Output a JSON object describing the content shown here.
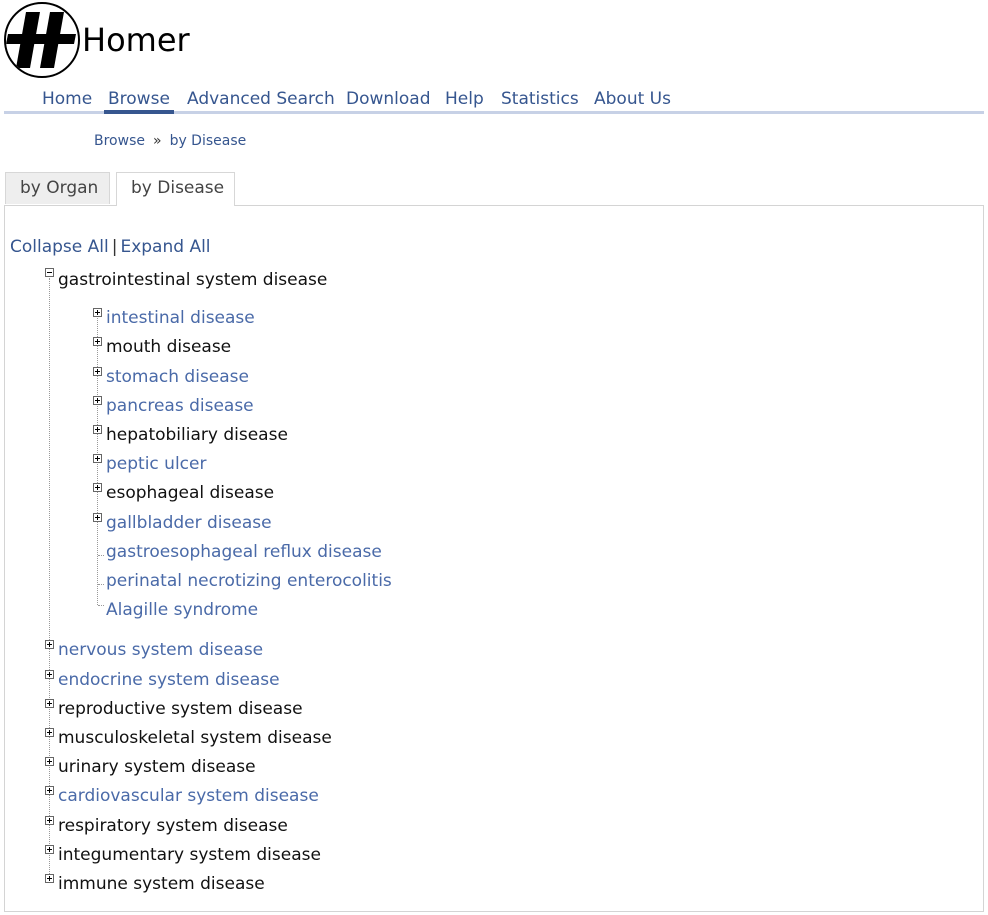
{
  "site": {
    "logo_letter": "H",
    "name": "Homer"
  },
  "nav": [
    {
      "label": "Home"
    },
    {
      "label": "Browse",
      "active": true
    },
    {
      "label": "Advanced Search"
    },
    {
      "label": "Download"
    },
    {
      "label": "Help"
    },
    {
      "label": "Statistics"
    },
    {
      "label": "About Us"
    }
  ],
  "breadcrumb": {
    "items": [
      "Browse",
      "by Disease"
    ],
    "separator": "»"
  },
  "tabs": [
    {
      "label": "by Organ",
      "active": false
    },
    {
      "label": "by Disease",
      "active": true
    }
  ],
  "tree_controls": {
    "collapse_all": "Collapse All",
    "divider": "|",
    "expand_all": "Expand All"
  },
  "tree": {
    "root": {
      "label": "gastrointestinal system disease",
      "expanded": true
    },
    "children": [
      {
        "label": "intestinal disease",
        "link": true,
        "expandable": true
      },
      {
        "label": "mouth disease",
        "link": false,
        "expandable": true
      },
      {
        "label": "stomach disease",
        "link": true,
        "expandable": true
      },
      {
        "label": "pancreas disease",
        "link": true,
        "expandable": true
      },
      {
        "label": "hepatobiliary disease",
        "link": false,
        "expandable": true
      },
      {
        "label": "peptic ulcer",
        "link": true,
        "expandable": true
      },
      {
        "label": "esophageal disease",
        "link": false,
        "expandable": true
      },
      {
        "label": "gallbladder disease",
        "link": true,
        "expandable": true
      },
      {
        "label": "gastroesophageal reflux disease",
        "link": true,
        "expandable": false
      },
      {
        "label": "perinatal necrotizing enterocolitis",
        "link": true,
        "expandable": false
      },
      {
        "label": "Alagille syndrome",
        "link": true,
        "expandable": false
      }
    ],
    "siblings": [
      {
        "label": "nervous system disease",
        "link": true
      },
      {
        "label": "endocrine system disease",
        "link": true
      },
      {
        "label": "reproductive system disease",
        "link": false
      },
      {
        "label": "musculoskeletal system disease",
        "link": false
      },
      {
        "label": "urinary system disease",
        "link": false
      },
      {
        "label": "cardiovascular system disease",
        "link": true
      },
      {
        "label": "respiratory system disease",
        "link": false
      },
      {
        "label": "integumentary system disease",
        "link": false
      },
      {
        "label": "immune system disease",
        "link": false
      }
    ]
  },
  "colors": {
    "link": "#4a6aa8",
    "nav": "#36568f",
    "nav_underline": "#c7d1e6"
  }
}
